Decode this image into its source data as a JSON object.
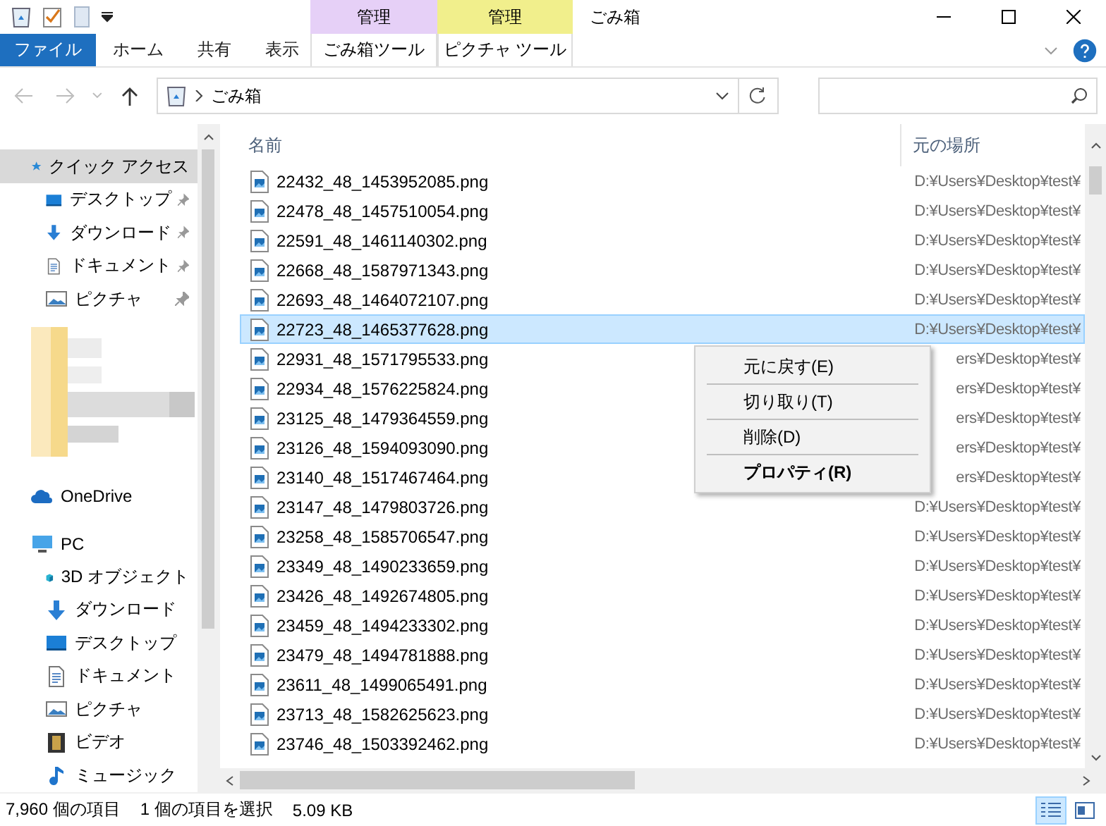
{
  "window": {
    "title": "ごみ箱"
  },
  "context_tabs": [
    {
      "header": "管理",
      "label": "ごみ箱ツール",
      "color": "#e6d0f7"
    },
    {
      "header": "管理",
      "label": "ピクチャ ツール",
      "color": "#f1ef8c"
    }
  ],
  "ribbon_tabs": [
    {
      "label": "ファイル",
      "kind": "file"
    },
    {
      "label": "ホーム",
      "kind": "tab"
    },
    {
      "label": "共有",
      "kind": "tab"
    },
    {
      "label": "表示",
      "kind": "tab"
    }
  ],
  "address": {
    "path": "ごみ箱"
  },
  "sidebar": {
    "items": [
      {
        "label": "クイック アクセス",
        "kind": "star",
        "selected": true,
        "children": [
          {
            "label": "デスクトップ",
            "kind": "desktop",
            "pinned": true,
            "selected": false
          },
          {
            "label": "ダウンロード",
            "kind": "download",
            "pinned": true,
            "selected": false
          },
          {
            "label": "ドキュメント",
            "kind": "document",
            "pinned": true,
            "selected": false
          },
          {
            "label": "ピクチャ",
            "kind": "picture",
            "pinned": true,
            "selected": false
          }
        ]
      },
      {
        "kind": "redacted"
      },
      {
        "label": "OneDrive",
        "kind": "cloud",
        "selected": false
      },
      {
        "label": "PC",
        "kind": "pc",
        "selected": false,
        "children": [
          {
            "label": "3D オブジェクト",
            "kind": "cube",
            "pinned": false,
            "selected": false
          },
          {
            "label": "ダウンロード",
            "kind": "download",
            "pinned": false,
            "selected": false
          },
          {
            "label": "デスクトップ",
            "kind": "desktop",
            "pinned": false,
            "selected": false
          },
          {
            "label": "ドキュメント",
            "kind": "document",
            "pinned": false,
            "selected": false
          },
          {
            "label": "ピクチャ",
            "kind": "picture",
            "pinned": false,
            "selected": false
          },
          {
            "label": "ビデオ",
            "kind": "video",
            "pinned": false,
            "selected": false
          },
          {
            "label": "ミュージック",
            "kind": "music",
            "pinned": false,
            "selected": false
          }
        ]
      }
    ]
  },
  "table": {
    "columns": [
      "名前",
      "元の場所"
    ],
    "rows": [
      {
        "name": "22432_48_1453952085.png",
        "location": "D:¥Users¥Desktop¥test¥",
        "selected": false
      },
      {
        "name": "22478_48_1457510054.png",
        "location": "D:¥Users¥Desktop¥test¥",
        "selected": false
      },
      {
        "name": "22591_48_1461140302.png",
        "location": "D:¥Users¥Desktop¥test¥",
        "selected": false
      },
      {
        "name": "22668_48_1587971343.png",
        "location": "D:¥Users¥Desktop¥test¥",
        "selected": false
      },
      {
        "name": "22693_48_1464072107.png",
        "location": "D:¥Users¥Desktop¥test¥",
        "selected": false
      },
      {
        "name": "22723_48_1465377628.png",
        "location": "D:¥Users¥Desktop¥test¥",
        "selected": true
      },
      {
        "name": "22931_48_1571795533.png",
        "location": "ers¥Desktop¥test¥",
        "selected": false
      },
      {
        "name": "22934_48_1576225824.png",
        "location": "ers¥Desktop¥test¥",
        "selected": false
      },
      {
        "name": "23125_48_1479364559.png",
        "location": "ers¥Desktop¥test¥",
        "selected": false
      },
      {
        "name": "23126_48_1594093090.png",
        "location": "ers¥Desktop¥test¥",
        "selected": false
      },
      {
        "name": "23140_48_1517467464.png",
        "location": "ers¥Desktop¥test¥",
        "selected": false
      },
      {
        "name": "23147_48_1479803726.png",
        "location": "D:¥Users¥Desktop¥test¥",
        "selected": false
      },
      {
        "name": "23258_48_1585706547.png",
        "location": "D:¥Users¥Desktop¥test¥",
        "selected": false
      },
      {
        "name": "23349_48_1490233659.png",
        "location": "D:¥Users¥Desktop¥test¥",
        "selected": false
      },
      {
        "name": "23426_48_1492674805.png",
        "location": "D:¥Users¥Desktop¥test¥",
        "selected": false
      },
      {
        "name": "23459_48_1494233302.png",
        "location": "D:¥Users¥Desktop¥test¥",
        "selected": false
      },
      {
        "name": "23479_48_1494781888.png",
        "location": "D:¥Users¥Desktop¥test¥",
        "selected": false
      },
      {
        "name": "23611_48_1499065491.png",
        "location": "D:¥Users¥Desktop¥test¥",
        "selected": false
      },
      {
        "name": "23713_48_1582625623.png",
        "location": "D:¥Users¥Desktop¥test¥",
        "selected": false
      },
      {
        "name": "23746_48_1503392462.png",
        "location": "D:¥Users¥Desktop¥test¥",
        "selected": false
      }
    ]
  },
  "context_menu": {
    "items": [
      {
        "label": "元に戻す(E)",
        "default": false
      },
      {
        "label": "切り取り(T)",
        "default": false
      },
      {
        "label": "削除(D)",
        "default": false
      },
      {
        "label": "プロパティ(R)",
        "default": true
      }
    ]
  },
  "status_bar": {
    "count": "7,960 個の項目",
    "selection": "1 個の項目を選択",
    "size": "5.09 KB",
    "views": [
      {
        "kind": "details",
        "selected": true
      },
      {
        "kind": "tiles",
        "selected": false
      }
    ]
  }
}
